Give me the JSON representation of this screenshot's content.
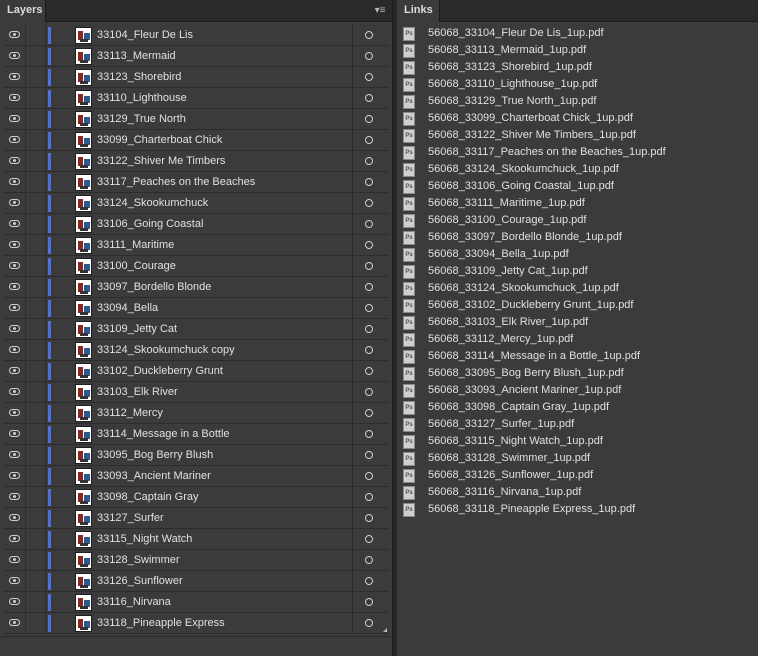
{
  "layers": {
    "tab_label": "Layers",
    "menu_icon": "panel-menu-icon",
    "items": [
      "33104_Fleur De Lis",
      "33113_Mermaid",
      "33123_Shorebird",
      "33110_Lighthouse",
      "33129_True North",
      "33099_Charterboat Chick",
      "33122_Shiver Me Timbers",
      "33117_Peaches on the Beaches",
      "33124_Skookumchuck",
      "33106_Going Coastal",
      "33111_Maritime",
      "33100_Courage",
      "33097_Bordello Blonde",
      "33094_Bella",
      "33109_Jetty Cat",
      "33124_Skookumchuck copy",
      "33102_Duckleberry Grunt",
      "33103_Elk River",
      "33112_Mercy",
      "33114_Message in a Bottle",
      "33095_Bog Berry Blush",
      "33093_Ancient Mariner",
      "33098_Captain Gray",
      "33127_Surfer",
      "33115_Night Watch",
      "33128_Swimmer",
      "33126_Sunflower",
      "33116_Nirvana",
      "33118_Pineapple Express"
    ],
    "layer_color": "#4f6fdc"
  },
  "links": {
    "tab_label": "Links",
    "file_icon": "ps-file-icon",
    "file_icon_text": "Ps",
    "items": [
      "56068_33104_Fleur De Lis_1up.pdf",
      "56068_33113_Mermaid_1up.pdf",
      "56068_33123_Shorebird_1up.pdf",
      "56068_33110_Lighthouse_1up.pdf",
      "56068_33129_True North_1up.pdf",
      "56068_33099_Charterboat Chick_1up.pdf",
      "56068_33122_Shiver Me Timbers_1up.pdf",
      "56068_33117_Peaches on the Beaches_1up.pdf",
      "56068_33124_Skookumchuck_1up.pdf",
      "56068_33106_Going Coastal_1up.pdf",
      "56068_33111_Maritime_1up.pdf",
      "56068_33100_Courage_1up.pdf",
      "56068_33097_Bordello Blonde_1up.pdf",
      "56068_33094_Bella_1up.pdf",
      "56068_33109_Jetty Cat_1up.pdf",
      "56068_33124_Skookumchuck_1up.pdf",
      "56068_33102_Duckleberry Grunt_1up.pdf",
      "56068_33103_Elk River_1up.pdf",
      "56068_33112_Mercy_1up.pdf",
      "56068_33114_Message in a Bottle_1up.pdf",
      "56068_33095_Bog Berry Blush_1up.pdf",
      "56068_33093_Ancient Mariner_1up.pdf",
      "56068_33098_Captain Gray_1up.pdf",
      "56068_33127_Surfer_1up.pdf",
      "56068_33115_Night Watch_1up.pdf",
      "56068_33128_Swimmer_1up.pdf",
      "56068_33126_Sunflower_1up.pdf",
      "56068_33116_Nirvana_1up.pdf",
      "56068_33118_Pineapple Express_1up.pdf"
    ]
  }
}
